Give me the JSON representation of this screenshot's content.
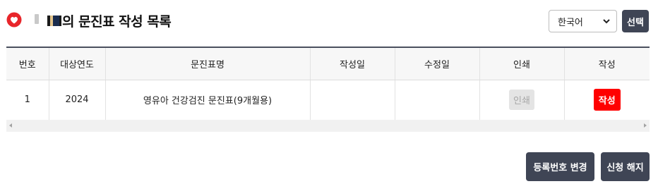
{
  "header": {
    "title_suffix": "의 문진표 작성 목록"
  },
  "language": {
    "selected": "한국어",
    "options": [
      "한국어"
    ],
    "confirm_label": "선택"
  },
  "table": {
    "columns": [
      "번호",
      "대상연도",
      "문진표명",
      "작성일",
      "수정일",
      "인쇄",
      "작성"
    ],
    "rows": [
      {
        "no": "1",
        "year": "2024",
        "name": "영유아 건강검진 문진표(9개월용)",
        "created": "",
        "modified": "",
        "print_label": "인쇄",
        "write_label": "작성"
      }
    ]
  },
  "footer": {
    "change_number_label": "등록번호 변경",
    "cancel_label": "신청 해지"
  },
  "colors": {
    "primary_button": "#3f4555",
    "write_button": "#ff0000",
    "disabled_button": "#e4e4e4",
    "logo": "#e8262b"
  }
}
